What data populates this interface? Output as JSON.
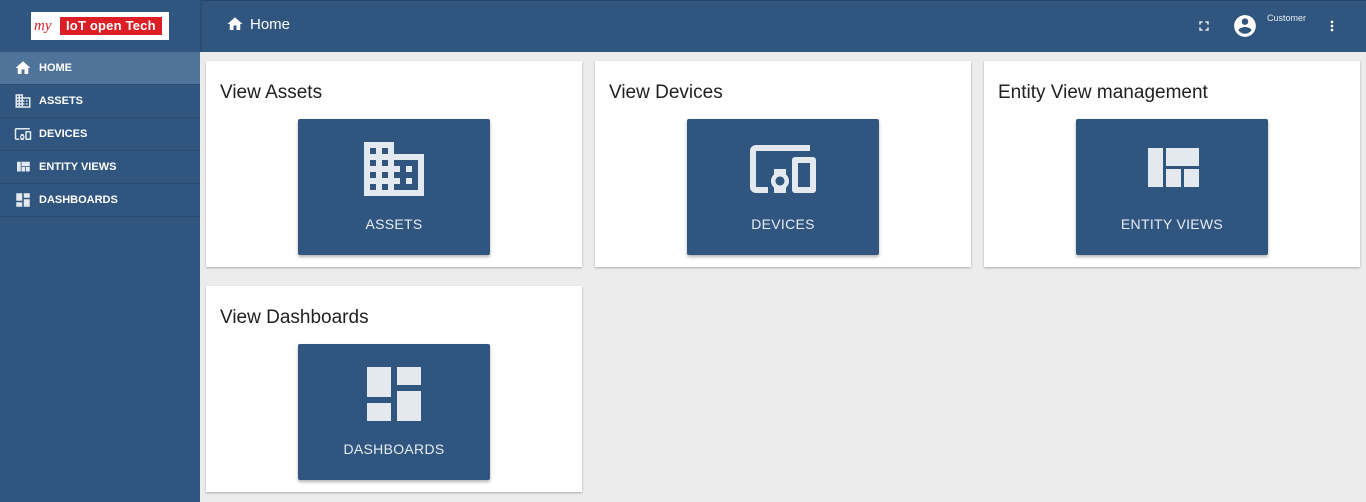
{
  "header": {
    "logo": {
      "prefix": "my",
      "brand": "IoT open Tech"
    },
    "breadcrumb": {
      "icon": "home-icon",
      "label": "Home"
    },
    "user": {
      "icon": "account-circle-icon",
      "name": "Customer"
    },
    "actions": {
      "fullscreen_icon": "fullscreen-icon",
      "menu_icon": "more-vert-icon"
    }
  },
  "sidebar": {
    "items": [
      {
        "label": "HOME",
        "icon": "home-icon",
        "active": true
      },
      {
        "label": "ASSETS",
        "icon": "domain-icon",
        "active": false
      },
      {
        "label": "DEVICES",
        "icon": "devices-other-icon",
        "active": false
      },
      {
        "label": "ENTITY VIEWS",
        "icon": "view-quilt-icon",
        "active": false
      },
      {
        "label": "DASHBOARDS",
        "icon": "dashboard-icon",
        "active": false
      }
    ]
  },
  "main": {
    "cards": [
      {
        "title": "View Assets",
        "button": "ASSETS",
        "icon": "domain-icon"
      },
      {
        "title": "View Devices",
        "button": "DEVICES",
        "icon": "devices-other-icon"
      },
      {
        "title": "Entity View management",
        "button": "ENTITY VIEWS",
        "icon": "view-quilt-icon"
      },
      {
        "title": "View Dashboards",
        "button": "DASHBOARDS",
        "icon": "dashboard-icon"
      }
    ]
  },
  "colors": {
    "primary": "#305680",
    "sidebar_active": "#4f7399",
    "background": "#ececec",
    "logo_red": "#dc1f26"
  }
}
